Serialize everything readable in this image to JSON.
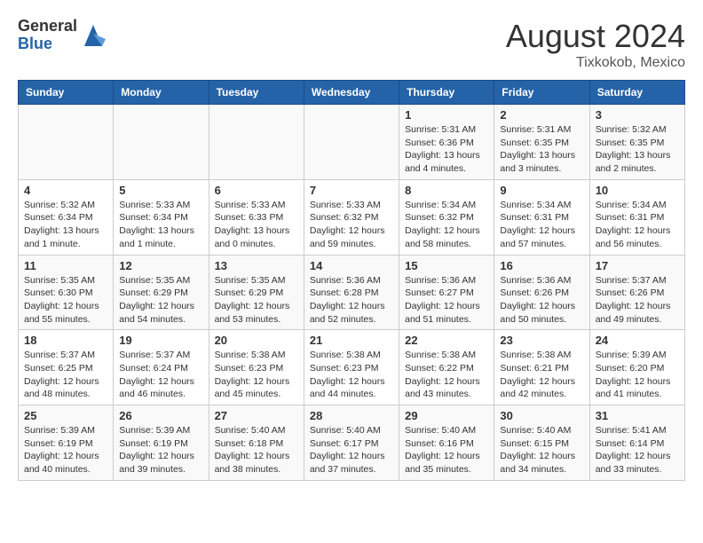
{
  "logo": {
    "general": "General",
    "blue": "Blue"
  },
  "title": "August 2024",
  "location": "Tixkokob, Mexico",
  "days_of_week": [
    "Sunday",
    "Monday",
    "Tuesday",
    "Wednesday",
    "Thursday",
    "Friday",
    "Saturday"
  ],
  "weeks": [
    [
      {
        "day": "",
        "info": ""
      },
      {
        "day": "",
        "info": ""
      },
      {
        "day": "",
        "info": ""
      },
      {
        "day": "",
        "info": ""
      },
      {
        "day": "1",
        "info": "Sunrise: 5:31 AM\nSunset: 6:36 PM\nDaylight: 13 hours\nand 4 minutes."
      },
      {
        "day": "2",
        "info": "Sunrise: 5:31 AM\nSunset: 6:35 PM\nDaylight: 13 hours\nand 3 minutes."
      },
      {
        "day": "3",
        "info": "Sunrise: 5:32 AM\nSunset: 6:35 PM\nDaylight: 13 hours\nand 2 minutes."
      }
    ],
    [
      {
        "day": "4",
        "info": "Sunrise: 5:32 AM\nSunset: 6:34 PM\nDaylight: 13 hours\nand 1 minute."
      },
      {
        "day": "5",
        "info": "Sunrise: 5:33 AM\nSunset: 6:34 PM\nDaylight: 13 hours\nand 1 minute."
      },
      {
        "day": "6",
        "info": "Sunrise: 5:33 AM\nSunset: 6:33 PM\nDaylight: 13 hours\nand 0 minutes."
      },
      {
        "day": "7",
        "info": "Sunrise: 5:33 AM\nSunset: 6:32 PM\nDaylight: 12 hours\nand 59 minutes."
      },
      {
        "day": "8",
        "info": "Sunrise: 5:34 AM\nSunset: 6:32 PM\nDaylight: 12 hours\nand 58 minutes."
      },
      {
        "day": "9",
        "info": "Sunrise: 5:34 AM\nSunset: 6:31 PM\nDaylight: 12 hours\nand 57 minutes."
      },
      {
        "day": "10",
        "info": "Sunrise: 5:34 AM\nSunset: 6:31 PM\nDaylight: 12 hours\nand 56 minutes."
      }
    ],
    [
      {
        "day": "11",
        "info": "Sunrise: 5:35 AM\nSunset: 6:30 PM\nDaylight: 12 hours\nand 55 minutes."
      },
      {
        "day": "12",
        "info": "Sunrise: 5:35 AM\nSunset: 6:29 PM\nDaylight: 12 hours\nand 54 minutes."
      },
      {
        "day": "13",
        "info": "Sunrise: 5:35 AM\nSunset: 6:29 PM\nDaylight: 12 hours\nand 53 minutes."
      },
      {
        "day": "14",
        "info": "Sunrise: 5:36 AM\nSunset: 6:28 PM\nDaylight: 12 hours\nand 52 minutes."
      },
      {
        "day": "15",
        "info": "Sunrise: 5:36 AM\nSunset: 6:27 PM\nDaylight: 12 hours\nand 51 minutes."
      },
      {
        "day": "16",
        "info": "Sunrise: 5:36 AM\nSunset: 6:26 PM\nDaylight: 12 hours\nand 50 minutes."
      },
      {
        "day": "17",
        "info": "Sunrise: 5:37 AM\nSunset: 6:26 PM\nDaylight: 12 hours\nand 49 minutes."
      }
    ],
    [
      {
        "day": "18",
        "info": "Sunrise: 5:37 AM\nSunset: 6:25 PM\nDaylight: 12 hours\nand 48 minutes."
      },
      {
        "day": "19",
        "info": "Sunrise: 5:37 AM\nSunset: 6:24 PM\nDaylight: 12 hours\nand 46 minutes."
      },
      {
        "day": "20",
        "info": "Sunrise: 5:38 AM\nSunset: 6:23 PM\nDaylight: 12 hours\nand 45 minutes."
      },
      {
        "day": "21",
        "info": "Sunrise: 5:38 AM\nSunset: 6:23 PM\nDaylight: 12 hours\nand 44 minutes."
      },
      {
        "day": "22",
        "info": "Sunrise: 5:38 AM\nSunset: 6:22 PM\nDaylight: 12 hours\nand 43 minutes."
      },
      {
        "day": "23",
        "info": "Sunrise: 5:38 AM\nSunset: 6:21 PM\nDaylight: 12 hours\nand 42 minutes."
      },
      {
        "day": "24",
        "info": "Sunrise: 5:39 AM\nSunset: 6:20 PM\nDaylight: 12 hours\nand 41 minutes."
      }
    ],
    [
      {
        "day": "25",
        "info": "Sunrise: 5:39 AM\nSunset: 6:19 PM\nDaylight: 12 hours\nand 40 minutes."
      },
      {
        "day": "26",
        "info": "Sunrise: 5:39 AM\nSunset: 6:19 PM\nDaylight: 12 hours\nand 39 minutes."
      },
      {
        "day": "27",
        "info": "Sunrise: 5:40 AM\nSunset: 6:18 PM\nDaylight: 12 hours\nand 38 minutes."
      },
      {
        "day": "28",
        "info": "Sunrise: 5:40 AM\nSunset: 6:17 PM\nDaylight: 12 hours\nand 37 minutes."
      },
      {
        "day": "29",
        "info": "Sunrise: 5:40 AM\nSunset: 6:16 PM\nDaylight: 12 hours\nand 35 minutes."
      },
      {
        "day": "30",
        "info": "Sunrise: 5:40 AM\nSunset: 6:15 PM\nDaylight: 12 hours\nand 34 minutes."
      },
      {
        "day": "31",
        "info": "Sunrise: 5:41 AM\nSunset: 6:14 PM\nDaylight: 12 hours\nand 33 minutes."
      }
    ]
  ]
}
